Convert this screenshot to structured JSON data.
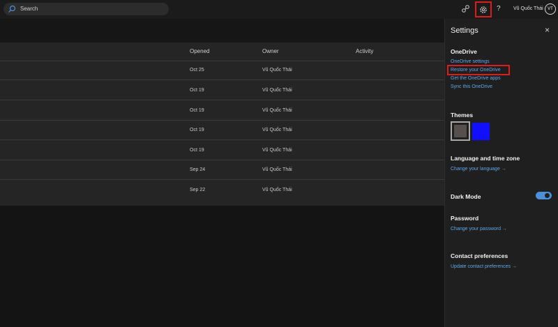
{
  "topbar": {
    "search_placeholder": "Search",
    "icons": [
      "search-icon",
      "share-icon",
      "gear-icon",
      "help-icon"
    ],
    "help_label": "?",
    "user_name": "Vũ Quốc Thái",
    "avatar_initials": "VT"
  },
  "table": {
    "headers": {
      "opened": "Opened",
      "owner": "Owner",
      "activity": "Activity"
    },
    "rows": [
      {
        "opened": "Oct 25",
        "owner": "Vũ Quốc Thái"
      },
      {
        "opened": "Oct 19",
        "owner": "Vũ Quốc Thái"
      },
      {
        "opened": "Oct 19",
        "owner": "Vũ Quốc Thái"
      },
      {
        "opened": "Oct 19",
        "owner": "Vũ Quốc Thái"
      },
      {
        "opened": "Oct 19",
        "owner": "Vũ Quốc Thái"
      },
      {
        "opened": "Sep 24",
        "owner": "Vũ Quốc Thái"
      },
      {
        "opened": "Sep 22",
        "owner": "Vũ Quốc Thái"
      }
    ]
  },
  "settings": {
    "title": "Settings",
    "close": "×",
    "onedrive": {
      "heading": "OneDrive",
      "links": [
        "OneDrive settings",
        "Restore your OneDrive",
        "Get the OneDrive apps",
        "Sync this OneDrive"
      ]
    },
    "themes": {
      "heading": "Themes",
      "colors": [
        "#574f4c",
        "#1010ff"
      ]
    },
    "language": {
      "heading": "Language and time zone",
      "link": "Change your language →"
    },
    "dark_mode": {
      "label": "Dark Mode",
      "enabled": true
    },
    "password": {
      "heading": "Password",
      "link": "Change your password →"
    },
    "contact": {
      "heading": "Contact preferences",
      "link": "Update contact preferences →"
    }
  },
  "colors": {
    "accent": "#4a90d9",
    "link": "#5ea8ea",
    "highlight": "#e21a1a"
  }
}
